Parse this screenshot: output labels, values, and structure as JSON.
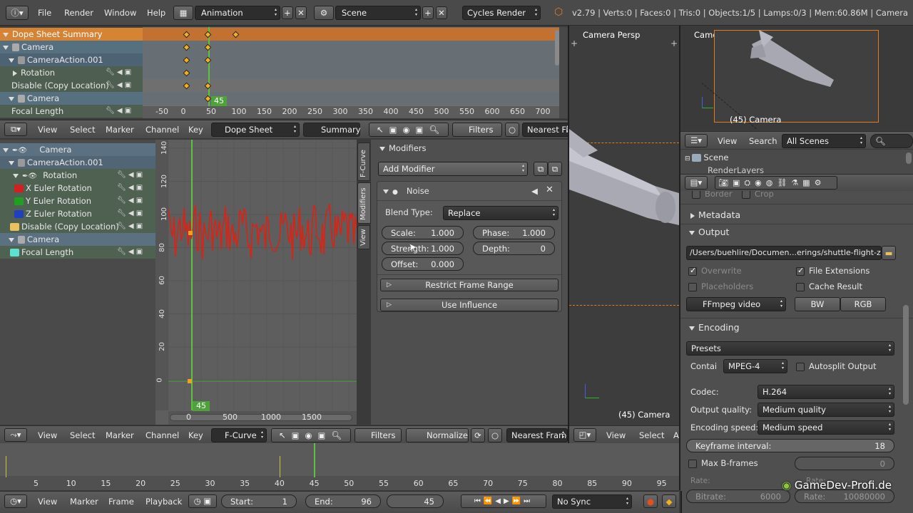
{
  "topbar": {
    "menus": [
      "File",
      "Render",
      "Window",
      "Help"
    ],
    "layout": "Animation",
    "scene": "Scene",
    "engine": "Cycles Render",
    "stats": "v2.79 | Verts:0 | Faces:0 | Tris:0 | Objects:1/5 | Lamps:0/3 | Mem:60.86M | Camera"
  },
  "dopesheet": {
    "channels": [
      "Dope Sheet Summary",
      "Camera",
      "CameraAction.001",
      "Rotation",
      "Disable (Copy Location)",
      "Camera",
      "Focal Length"
    ],
    "ruler": [
      "-50",
      "0",
      "50",
      "100",
      "150",
      "200",
      "250",
      "300",
      "350",
      "400",
      "450",
      "500",
      "550",
      "600",
      "650",
      "700"
    ],
    "frame": "45",
    "header": {
      "menus": [
        "View",
        "Select",
        "Marker",
        "Channel",
        "Key"
      ],
      "mode": "Dope Sheet",
      "summary": "Summary",
      "filters": "Filters",
      "nearest": "Nearest Fra"
    }
  },
  "graph": {
    "channels": [
      "Camera",
      "CameraAction.001",
      "Rotation",
      "X Euler Rotation",
      "Y Euler Rotation",
      "Z Euler Rotation",
      "Disable (Copy Location)",
      "Camera",
      "Focal Length"
    ],
    "yticks": [
      "140",
      "120",
      "100",
      "80",
      "60",
      "40",
      "20",
      "0"
    ],
    "xticks": [
      "0",
      "500",
      "1000",
      "1500"
    ],
    "frame": "45",
    "header": {
      "menus": [
        "View",
        "Select",
        "Marker",
        "Channel",
        "Key"
      ],
      "mode": "F-Curve",
      "filters": "Filters",
      "normalize": "Normalize",
      "nearest": "Nearest Frame"
    }
  },
  "modifiers": {
    "tabs": [
      "F-Curve",
      "Modifiers",
      "View"
    ],
    "title": "Modifiers",
    "add": "Add Modifier",
    "noise": "Noise",
    "blend_label": "Blend Type:",
    "blend": "Replace",
    "scale_label": "Scale:",
    "scale": "1.000",
    "phase_label": "Phase:",
    "phase": "1.000",
    "strength_label": "Strength:",
    "strength": "1.000",
    "depth_label": "Depth:",
    "depth": "0",
    "offset_label": "Offset:",
    "offset": "0.000",
    "restrict": "Restrict Frame Range",
    "influence": "Use Influence"
  },
  "viewport": {
    "title": "Camera Persp",
    "caption": "(45) Camera",
    "header": {
      "menus": [
        "View",
        "Select",
        "A"
      ]
    }
  },
  "camview": {
    "title": "Camera Persp",
    "caption": "(45) Camera"
  },
  "outliner": {
    "menus": [
      "View",
      "Search"
    ],
    "scenes": "All Scenes",
    "scene": "Scene",
    "renderlayers": "RenderLayers"
  },
  "props": {
    "border": "Border",
    "crop": "Crop",
    "metadata": "Metadata",
    "output": "Output",
    "path": "/Users/buehlire/Documen...erings/shuttle-flight-zoom",
    "overwrite": "Overwrite",
    "file_ext": "File Extensions",
    "placeholders": "Placeholders",
    "cache": "Cache Result",
    "format": "FFmpeg video",
    "bw": "BW",
    "rgb": "RGB",
    "encoding": "Encoding",
    "presets": "Presets",
    "container_label": "Contai",
    "container": "MPEG-4",
    "autosplit": "Autosplit Output",
    "codec_label": "Codec:",
    "codec": "H.264",
    "quality_label": "Output quality:",
    "quality": "Medium quality",
    "speed_label": "Encoding speed:",
    "speed": "Medium speed",
    "keyframe_label": "Keyframe interval:",
    "keyframe": "18",
    "maxb": "Max B-frames",
    "maxb_val": "0",
    "rate": "Rate:",
    "bitrate_label": "Bitrate:",
    "bitrate": "6000",
    "rate2": "Rate:",
    "rate2_val": "10080000",
    "watermark": "GameDev-Profi.de"
  },
  "timeline": {
    "ticks": [
      "5",
      "10",
      "15",
      "20",
      "25",
      "30",
      "35",
      "40",
      "45",
      "50",
      "55",
      "60",
      "65",
      "70",
      "75",
      "80",
      "85",
      "90",
      "95"
    ],
    "header": {
      "menus": [
        "View",
        "Marker",
        "Frame",
        "Playback"
      ],
      "start_label": "Start:",
      "start": "1",
      "end_label": "End:",
      "end": "96",
      "current": "45",
      "sync": "No Sync"
    }
  },
  "colors": {
    "accent": "#e07c1f",
    "curve": "#e02010",
    "playhead": "#60c040",
    "key": "#f0b020"
  }
}
